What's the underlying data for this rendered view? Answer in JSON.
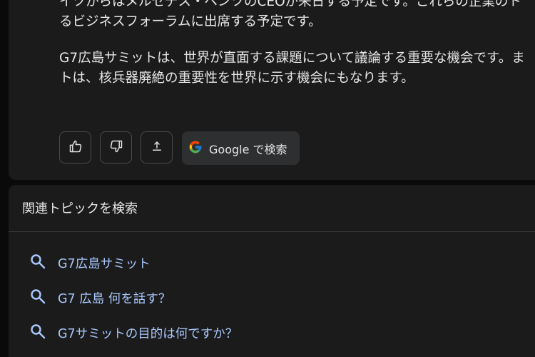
{
  "response": {
    "paragraph1": [
      "イツからはメルセデス・ベンツのCEOが来日する予定です。これらの企業のト",
      "るビジネスフォーラムに出席する予定です。"
    ],
    "paragraph2": [
      "G7広島サミットは、世界が直面する課題について議論する重要な機会です。ま",
      "トは、核兵器廃絶の重要性を世界に示す機会にもなります。"
    ]
  },
  "actions": {
    "like_icon": "thumbs-up-icon",
    "dislike_icon": "thumbs-down-icon",
    "share_icon": "share-icon",
    "google_label": "Google で検索"
  },
  "related": {
    "title": "関連トピックを検索",
    "items": [
      "G7広島サミット",
      "G7 広島 何を話す？",
      "G7サミットの目的は何ですか？"
    ]
  },
  "colors": {
    "background": "#0a0a0a",
    "card": "#1b1b1c",
    "link": "#a8c7fa",
    "google_button": "#2e2f31"
  }
}
